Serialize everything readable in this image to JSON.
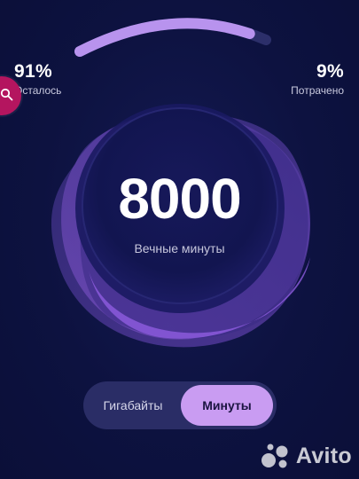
{
  "usage": {
    "remaining_percent": "91%",
    "remaining_label": "Осталось",
    "spent_percent": "9%",
    "spent_label": "Потрачено",
    "remaining_fraction": 0.91
  },
  "balance": {
    "value": "8000",
    "caption": "Вечные минуты"
  },
  "toggle": {
    "options": [
      {
        "label": "Гигабайты",
        "selected": false
      },
      {
        "label": "Минуты",
        "selected": true
      }
    ]
  },
  "watermark": {
    "text": "Avito"
  },
  "colors": {
    "background": "#0d1240",
    "accent": "#c99cf2",
    "search_button": "#b4155f",
    "arc_track": "#2c2f6a"
  },
  "icons": {
    "search": "search-icon",
    "watermark_logo": "avito-logo-icon"
  }
}
